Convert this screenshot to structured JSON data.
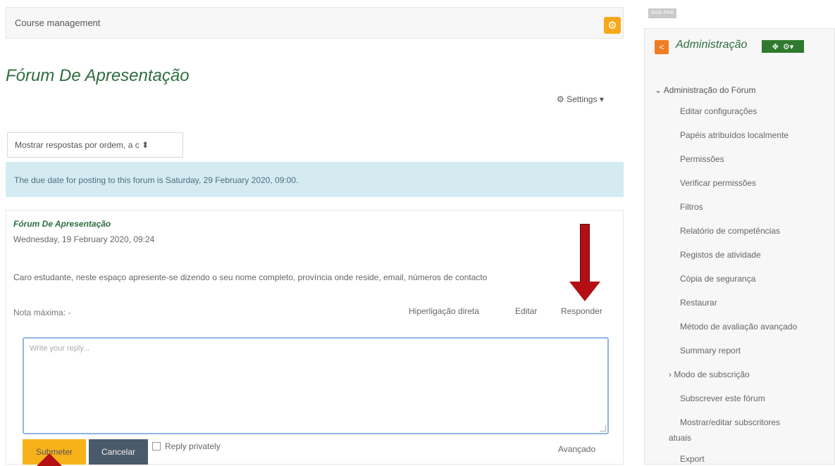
{
  "header": {
    "course_management": "Course management",
    "gear_icon": "gear-icon"
  },
  "forum": {
    "title": "Fórum De Apresentação",
    "settings_label": "Settings",
    "sort_select": "Mostrar respostas por ordem, a c",
    "notice": "The due date for posting to this forum is Saturday, 29 February 2020, 09:00."
  },
  "post": {
    "title": "Fórum De Apresentação",
    "date": "Wednesday, 19 February 2020, 09:24",
    "body": "Caro estudante, neste espaço apresente-se dizendo o seu nome completo, província onde reside, email,  números de contacto",
    "grade": "Nota máxima: -",
    "commands": [
      "Hiperligação direta",
      "Editar",
      "Responder"
    ]
  },
  "reply": {
    "placeholder": "Write your reply...",
    "submit_label": "Submeter",
    "cancel_label": "Cancelar",
    "private_label": "Reply privately",
    "advanced_label": "Avançado"
  },
  "sidebar": {
    "tag": "SIDE-PRE",
    "title": "Administração",
    "root": "Administração do Fórum",
    "items": [
      "Editar configurações",
      "Papéis atribuídos localmente",
      "Permissões",
      "Verificar permissões",
      "Filtros",
      "Relatório de competências",
      "Registos de atividade",
      "Cópia de segurança",
      "Restaurar",
      "Método de avaliação avançado",
      "Summary report",
      "Modo de subscrição",
      "Subscrever este fórum",
      "Mostrar/editar subscritores",
      "atuais",
      "Export"
    ]
  },
  "colors": {
    "accent": "#f7b21b",
    "title_green": "#2e6e3e",
    "arrow_red": "#b30f14",
    "notice_bg": "#d5ebf2"
  }
}
